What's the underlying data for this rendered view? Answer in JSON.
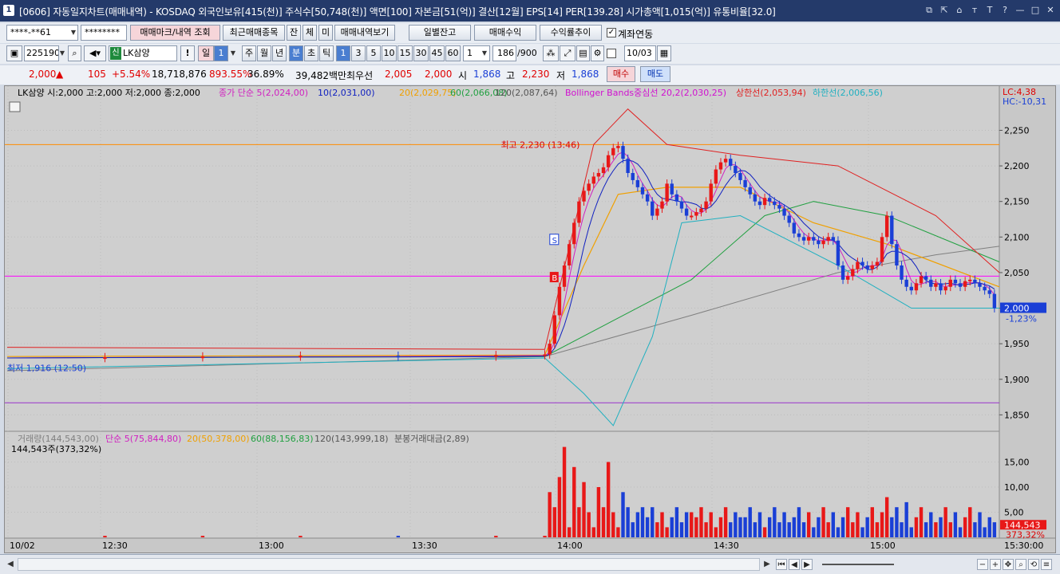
{
  "window": {
    "app_icon": "1",
    "title": "[0606] 자동일지차트(매매내역) - KOSDAQ 외국인보유[415(천)] 주식수[50,748(천)] 액면[100] 자본금[51(억)] 결산[12월] EPS[14] PER[139.28] 시가총액[1,015(억)] 유통비율[32.0]",
    "title_icons": [
      "restore-window-icon",
      "link-icon",
      "home-icon",
      "font-smaller-icon",
      "font-larger-icon",
      "help-icon",
      "minimize-icon",
      "maximize-icon",
      "close-icon"
    ]
  },
  "toolbar1": {
    "account": "****-**61",
    "password": "********",
    "trade_mark_btn": "매매마크/내역 조회",
    "recent_items_btn": "최근매매종목",
    "tab_jan": "잔",
    "tab_che": "체",
    "tab_mi": "미",
    "trade_history_btn": "매매내역보기",
    "daily_balance_btn": "일별잔고",
    "trade_profit_btn": "매매수익",
    "return_trend_btn": "수익률추이",
    "account_link_checked": true,
    "account_link_label": "계좌연동"
  },
  "toolbar2": {
    "stock_code": "225190",
    "stock_badge": "신",
    "stock_name": "LK삼양",
    "period_buttons": [
      {
        "label": "일",
        "selected": true
      },
      {
        "label": "1",
        "selected": true
      },
      {
        "label": "주",
        "selected": false
      },
      {
        "label": "월",
        "selected": false
      },
      {
        "label": "년",
        "selected": false
      },
      {
        "label": "분",
        "selected": true
      },
      {
        "label": "초",
        "selected": false
      },
      {
        "label": "틱",
        "selected": false
      }
    ],
    "interval_buttons": [
      {
        "label": "1",
        "selected": true
      },
      {
        "label": "3",
        "selected": false
      },
      {
        "label": "5",
        "selected": false
      },
      {
        "label": "10",
        "selected": false
      },
      {
        "label": "15",
        "selected": false
      },
      {
        "label": "30",
        "selected": false
      },
      {
        "label": "45",
        "selected": false
      },
      {
        "label": "60",
        "selected": false
      }
    ],
    "interval_value": "1",
    "bar_count": "186",
    "bar_total": "/900",
    "date": "10/03"
  },
  "quote": {
    "price": "2,000",
    "change_arrow": "▲",
    "change": "105",
    "change_pct": "+5.54%",
    "volume": "18,718,876",
    "volume_ratio": "893.55%",
    "turnover": "36.89%",
    "amount": "39,482백만",
    "priority_label": "최우선",
    "best_ask": "2,005",
    "best_bid": "2,000",
    "open_label": "시",
    "open": "1,868",
    "high_label": "고",
    "high": "2,230",
    "low_label": "저",
    "low": "1,868",
    "buy_btn": "매수",
    "sell_btn": "매도"
  },
  "chart_data": [
    {
      "type": "candlestick",
      "stock": "LK삼양",
      "header": {
        "ohlc": "LK삼양 시:2,000 고:2,000 저:2,000 종:2,000",
        "ma_label": "종가 단순 5(2,024,00)",
        "ma10": "10(2,031,00)",
        "ma20": "20(2,029,75)",
        "ma60": "60(2,066,08)",
        "ma120": "120(2,087,64)",
        "bb_center": "Bollinger Bands중심선 20,2(2,030,25)",
        "bb_upper": "상한선(2,053,94)",
        "bb_lower": "하한선(2,006,56)"
      },
      "right_top": {
        "lc": "LC:4,38",
        "hc": "HC:-10,31"
      },
      "ylim": [
        1828,
        2292
      ],
      "y_ticks": [
        "2,250",
        "2,200",
        "2,150",
        "2,100",
        "2,050",
        "2,000",
        "1,950",
        "1,900",
        "1,850"
      ],
      "y_tick_values": [
        2250,
        2200,
        2150,
        2100,
        2050,
        2000,
        1950,
        1900,
        1850
      ],
      "current_price_label": "2,000",
      "current_change_label": "-1,23%",
      "hlines": [
        {
          "value": 2230,
          "color": "#ff8c00"
        },
        {
          "value": 2045,
          "color": "#ff00ff"
        },
        {
          "value": 1867,
          "color": "#9932cc"
        }
      ],
      "annotations": {
        "high": "최고 2,230 (13:46)",
        "low": "최저 1,916 (12:50)",
        "sell_mark": "S",
        "buy_mark": "B"
      },
      "x_labels": [
        "10/02",
        "12:30",
        "13:00",
        "13:30",
        "14:00",
        "14:30",
        "15:00"
      ],
      "x_label_right": "15:30:00",
      "colors": {
        "up": "#e81818",
        "down": "#1a3fd6",
        "ma5": "#d020c0",
        "ma10": "#1020c0",
        "ma20": "#f0a000",
        "ma60": "#20a040",
        "ma120": "#808080",
        "bb_center": "#d010d0",
        "bb_upper": "#e02020",
        "bb_lower": "#20b0c0"
      },
      "price_series": [
        [
          0,
          1930
        ],
        [
          20,
          1931
        ],
        [
          40,
          1932
        ],
        [
          60,
          1933
        ],
        [
          80,
          1932
        ],
        [
          100,
          1934
        ],
        [
          110,
          1935
        ],
        [
          111,
          1950
        ],
        [
          112,
          1990
        ],
        [
          113,
          2030
        ],
        [
          114,
          2060
        ],
        [
          115,
          2090
        ],
        [
          116,
          2120
        ],
        [
          117,
          2150
        ],
        [
          118,
          2165
        ],
        [
          119,
          2175
        ],
        [
          120,
          2185
        ],
        [
          121,
          2190
        ],
        [
          122,
          2198
        ],
        [
          123,
          2215
        ],
        [
          124,
          2225
        ],
        [
          125,
          2228
        ],
        [
          126,
          2210
        ],
        [
          127,
          2190
        ],
        [
          128,
          2180
        ],
        [
          129,
          2170
        ],
        [
          130,
          2160
        ],
        [
          131,
          2150
        ],
        [
          132,
          2130
        ],
        [
          133,
          2140
        ],
        [
          134,
          2150
        ],
        [
          135,
          2175
        ],
        [
          136,
          2160
        ],
        [
          137,
          2150
        ],
        [
          138,
          2140
        ],
        [
          139,
          2130
        ],
        [
          140,
          2130
        ],
        [
          141,
          2135
        ],
        [
          142,
          2140
        ],
        [
          143,
          2150
        ],
        [
          144,
          2175
        ],
        [
          145,
          2195
        ],
        [
          146,
          2205
        ],
        [
          147,
          2210
        ],
        [
          148,
          2200
        ],
        [
          149,
          2190
        ],
        [
          150,
          2180
        ],
        [
          151,
          2170
        ],
        [
          152,
          2160
        ],
        [
          153,
          2150
        ],
        [
          154,
          2145
        ],
        [
          155,
          2155
        ],
        [
          156,
          2150
        ],
        [
          157,
          2145
        ],
        [
          158,
          2140
        ],
        [
          159,
          2130
        ],
        [
          160,
          2120
        ],
        [
          161,
          2105
        ],
        [
          162,
          2100
        ],
        [
          163,
          2095
        ],
        [
          164,
          2100
        ],
        [
          165,
          2095
        ],
        [
          166,
          2090
        ],
        [
          167,
          2095
        ],
        [
          168,
          2100
        ],
        [
          169,
          2095
        ],
        [
          170,
          2060
        ],
        [
          171,
          2040
        ],
        [
          172,
          2045
        ],
        [
          173,
          2055
        ],
        [
          174,
          2065
        ],
        [
          175,
          2060
        ],
        [
          176,
          2055
        ],
        [
          177,
          2060
        ],
        [
          178,
          2065
        ],
        [
          179,
          2100
        ],
        [
          180,
          2130
        ],
        [
          181,
          2090
        ],
        [
          182,
          2060
        ],
        [
          183,
          2040
        ],
        [
          184,
          2030
        ],
        [
          185,
          2025
        ],
        [
          186,
          2035
        ],
        [
          187,
          2045
        ],
        [
          188,
          2040
        ],
        [
          189,
          2030
        ],
        [
          190,
          2035
        ],
        [
          191,
          2025
        ],
        [
          192,
          2030
        ],
        [
          193,
          2040
        ],
        [
          194,
          2035
        ],
        [
          195,
          2030
        ],
        [
          196,
          2038
        ],
        [
          197,
          2040
        ],
        [
          198,
          2035
        ],
        [
          199,
          2030
        ],
        [
          200,
          2025
        ],
        [
          201,
          2020
        ],
        [
          202,
          2000
        ]
      ],
      "bb_upper_series": [
        [
          0,
          1945
        ],
        [
          110,
          1942
        ],
        [
          120,
          2230
        ],
        [
          127,
          2280
        ],
        [
          135,
          2230
        ],
        [
          150,
          2215
        ],
        [
          170,
          2200
        ],
        [
          190,
          2130
        ],
        [
          203,
          2050
        ]
      ],
      "bb_lower_series": [
        [
          0,
          1915
        ],
        [
          110,
          1930
        ],
        [
          118,
          1880
        ],
        [
          124,
          1835
        ],
        [
          132,
          1960
        ],
        [
          138,
          2120
        ],
        [
          150,
          2130
        ],
        [
          170,
          2060
        ],
        [
          185,
          2000
        ],
        [
          203,
          2000
        ]
      ],
      "ma60_series": [
        [
          0,
          1930
        ],
        [
          110,
          1932
        ],
        [
          140,
          2040
        ],
        [
          155,
          2130
        ],
        [
          165,
          2150
        ],
        [
          180,
          2130
        ],
        [
          203,
          2065
        ]
      ],
      "ma120_series": [
        [
          0,
          1912
        ],
        [
          110,
          1932
        ],
        [
          140,
          1990
        ],
        [
          170,
          2050
        ],
        [
          190,
          2075
        ],
        [
          203,
          2087
        ]
      ],
      "ma20_series": [
        [
          0,
          1932
        ],
        [
          110,
          1934
        ],
        [
          118,
          2060
        ],
        [
          125,
          2160
        ],
        [
          135,
          2170
        ],
        [
          150,
          2170
        ],
        [
          165,
          2120
        ],
        [
          180,
          2090
        ],
        [
          203,
          2030
        ]
      ]
    },
    {
      "type": "bar",
      "name": "volume",
      "header": {
        "vol": "거래량(144,543,00)",
        "ma5": "단순 5(75,844,80)",
        "ma20": "20(50,378,00)",
        "ma60": "60(88,156,83)",
        "ma120": "120(143,999,18)",
        "amount": "분봉거래대금(2,89)"
      },
      "current": "144,543주(373,32%)",
      "y_ticks": [
        "15,00",
        "10,00",
        "5,00"
      ],
      "y_tick_values": [
        15,
        10,
        5
      ],
      "ylim": [
        0,
        20
      ],
      "last_value_label": "144,543",
      "last_pct_label": "373,32%",
      "peak_bars": [
        [
          111,
          9
        ],
        [
          113,
          12
        ],
        [
          114,
          18
        ],
        [
          116,
          14
        ],
        [
          118,
          11
        ],
        [
          121,
          10
        ],
        [
          123,
          15
        ],
        [
          126,
          9
        ],
        [
          130,
          6
        ],
        [
          140,
          5
        ],
        [
          150,
          4
        ],
        [
          160,
          3
        ],
        [
          180,
          8
        ],
        [
          184,
          7
        ],
        [
          190,
          3
        ],
        [
          202,
          3
        ]
      ]
    }
  ],
  "bottom": {
    "scroll_left": "◀",
    "scroll_right": "▶",
    "zoom_out": "−",
    "zoom_in": "+"
  }
}
